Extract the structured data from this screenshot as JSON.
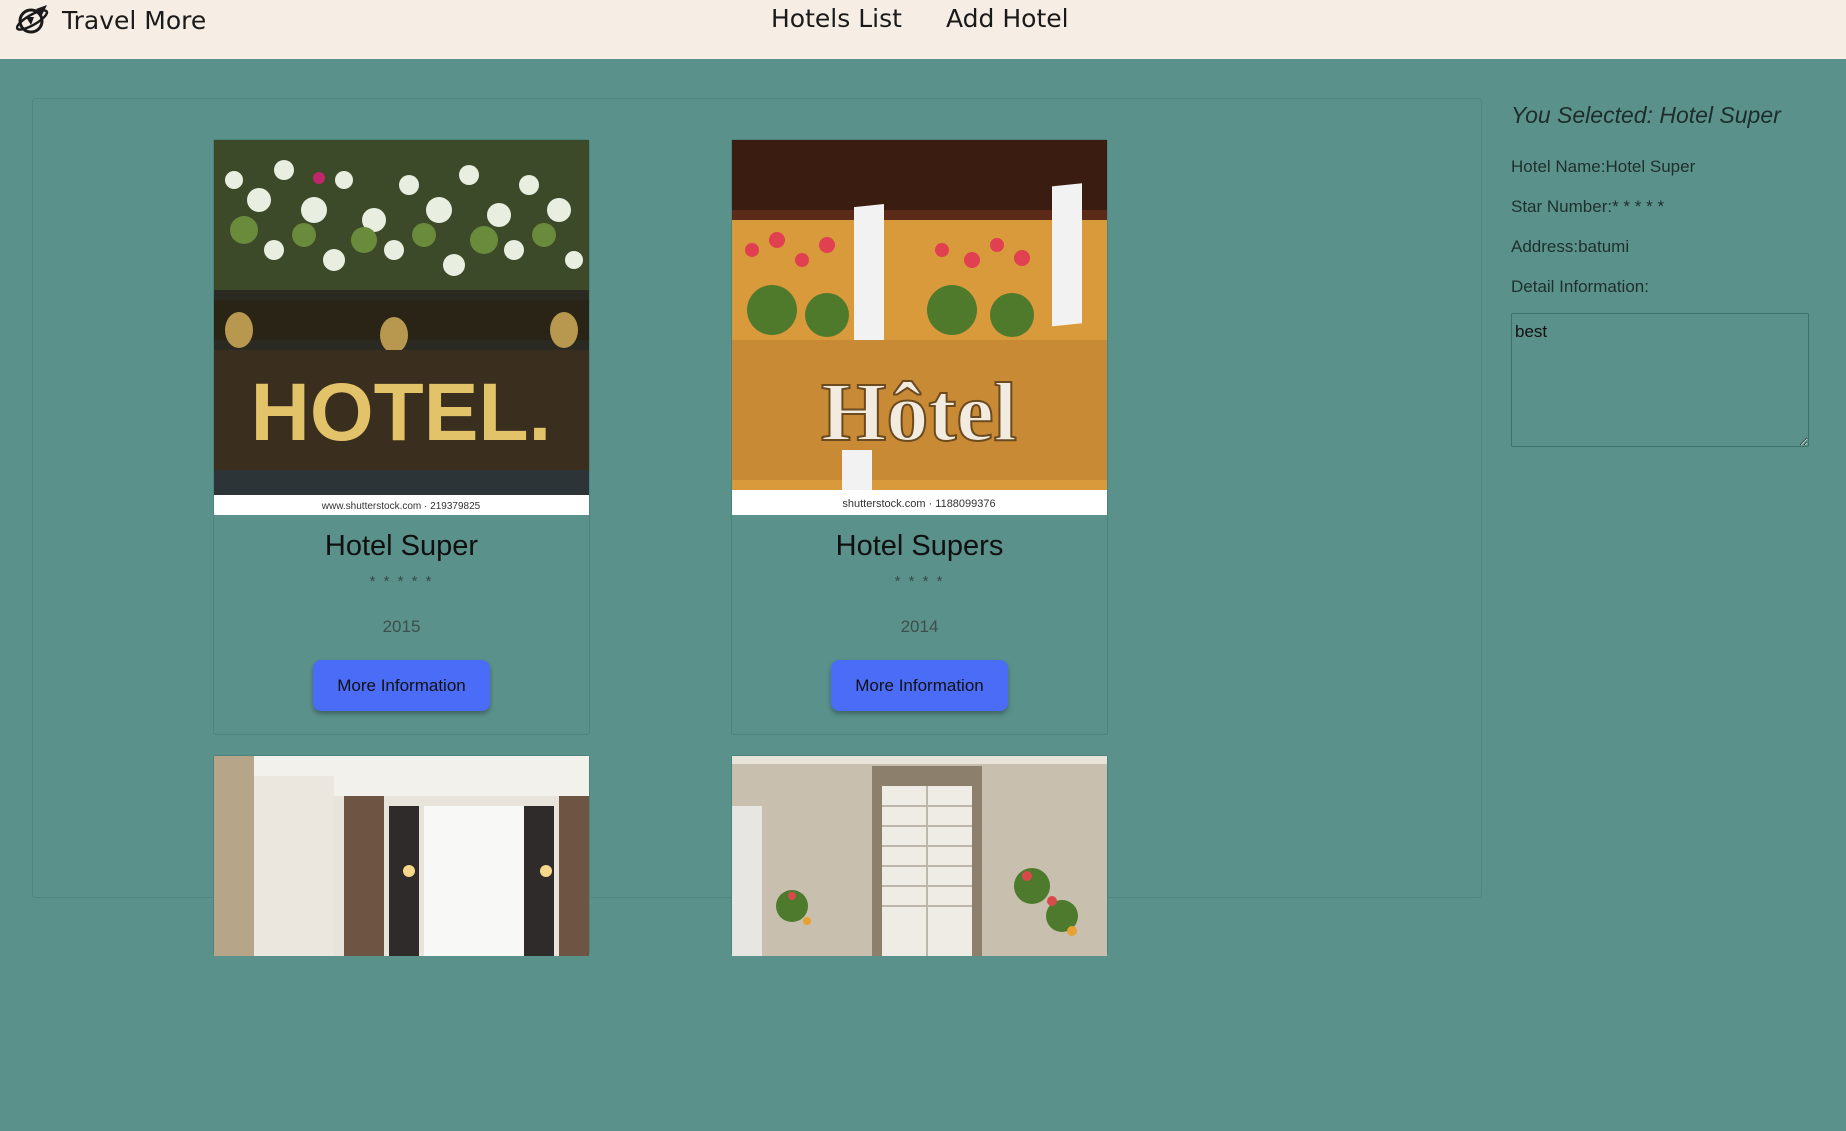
{
  "nav": {
    "brand": "Travel More",
    "links": [
      "Hotels List",
      "Add Hotel"
    ]
  },
  "hotels": [
    {
      "name": "Hotel Super",
      "stars": "* * * * *",
      "year": "2015",
      "button": "More Information",
      "image_caption": "www.shutterstock.com · 219379825",
      "sign": "HOTEL."
    },
    {
      "name": "Hotel Supers",
      "stars": "* * * *",
      "year": "2014",
      "button": "More Information",
      "image_caption": "shutterstock.com · 1188099376",
      "sign": "Hôtel"
    }
  ],
  "selected": {
    "heading": "You Selected: Hotel Super",
    "name_row": "Hotel Name:Hotel Super",
    "stars_row": "Star Number:* * * * *",
    "address_row": "Address:batumi",
    "detail_label": "Detail Information:",
    "detail_value": "best"
  },
  "colors": {
    "navbar_bg": "#f6eee4",
    "page_bg": "#5a918b",
    "button_bg": "#4a6cf7"
  }
}
